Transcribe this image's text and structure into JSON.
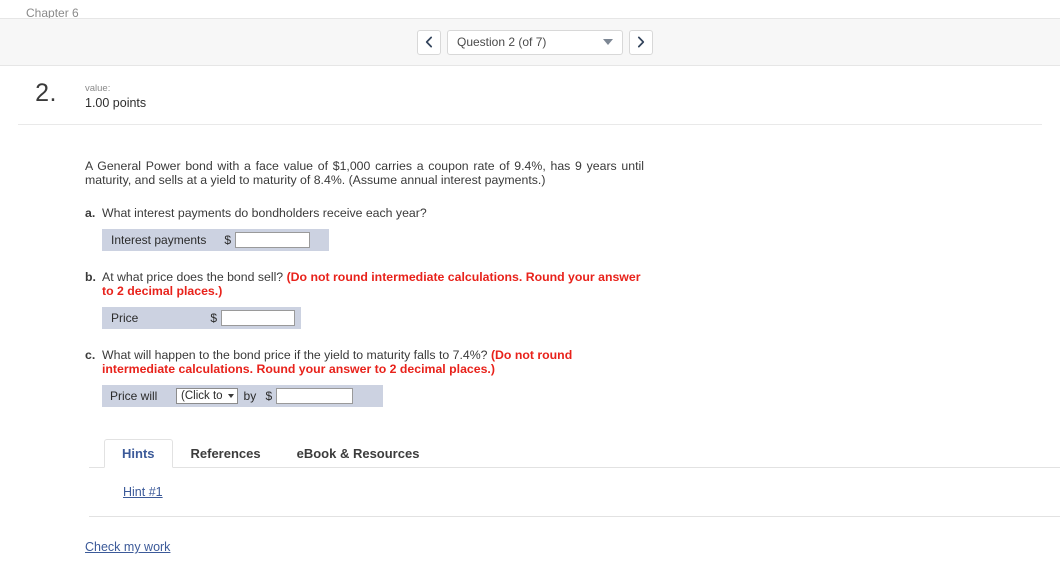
{
  "breadcrumb": {
    "label": "Chapter 6"
  },
  "navigation": {
    "prev_icon": "chevron-left-icon",
    "next_icon": "chevron-right-icon",
    "question_selector": "Question 2 (of 7)",
    "caret_icon": "chevron-down-icon"
  },
  "question": {
    "number": "2.",
    "value_label": "value:",
    "value_points": "1.00 points",
    "stem": "A General Power bond with a face value of $1,000 carries a coupon rate of 9.4%, has 9 years until maturity, and sells at a yield to maturity of 8.4%. (Assume annual interest payments.)",
    "parts": [
      {
        "letter": "a.",
        "text": "What interest payments do bondholders receive each year?",
        "red_text": "",
        "row_label": "Interest payments",
        "dollar": "$",
        "input_value": "",
        "input_placeholder": ""
      },
      {
        "letter": "b.",
        "text": "At what price does the bond sell? ",
        "red_text": "(Do not round intermediate calculations. Round your answer to 2 decimal places.)",
        "row_label": "Price",
        "dollar": "$",
        "input_value": "",
        "input_placeholder": ""
      },
      {
        "letter": "c.",
        "text": "What will happen to the bond price if the yield to maturity falls to 7.4%? ",
        "red_text": "(Do not round intermediate calculations. Round your answer to 2 decimal places.)",
        "row_label": "Price will",
        "select_value": "(Click to",
        "select_caret_icon": "caret-down-icon",
        "by_label": "by",
        "dollar": "$",
        "input_value": "",
        "input_placeholder": ""
      }
    ]
  },
  "tabs": [
    {
      "label": "Hints",
      "active": true
    },
    {
      "label": "References",
      "active": false
    },
    {
      "label": "eBook & Resources",
      "active": false
    }
  ],
  "hints_panel": {
    "hint_link": "Hint #1"
  },
  "footer": {
    "check_my_work": "Check my work"
  },
  "colors": {
    "accent_link": "#3c5a99",
    "red_instruction": "#e8221b",
    "answer_row_bg": "#ccd2e1",
    "nav_bar_bg": "#f7f7f7"
  }
}
